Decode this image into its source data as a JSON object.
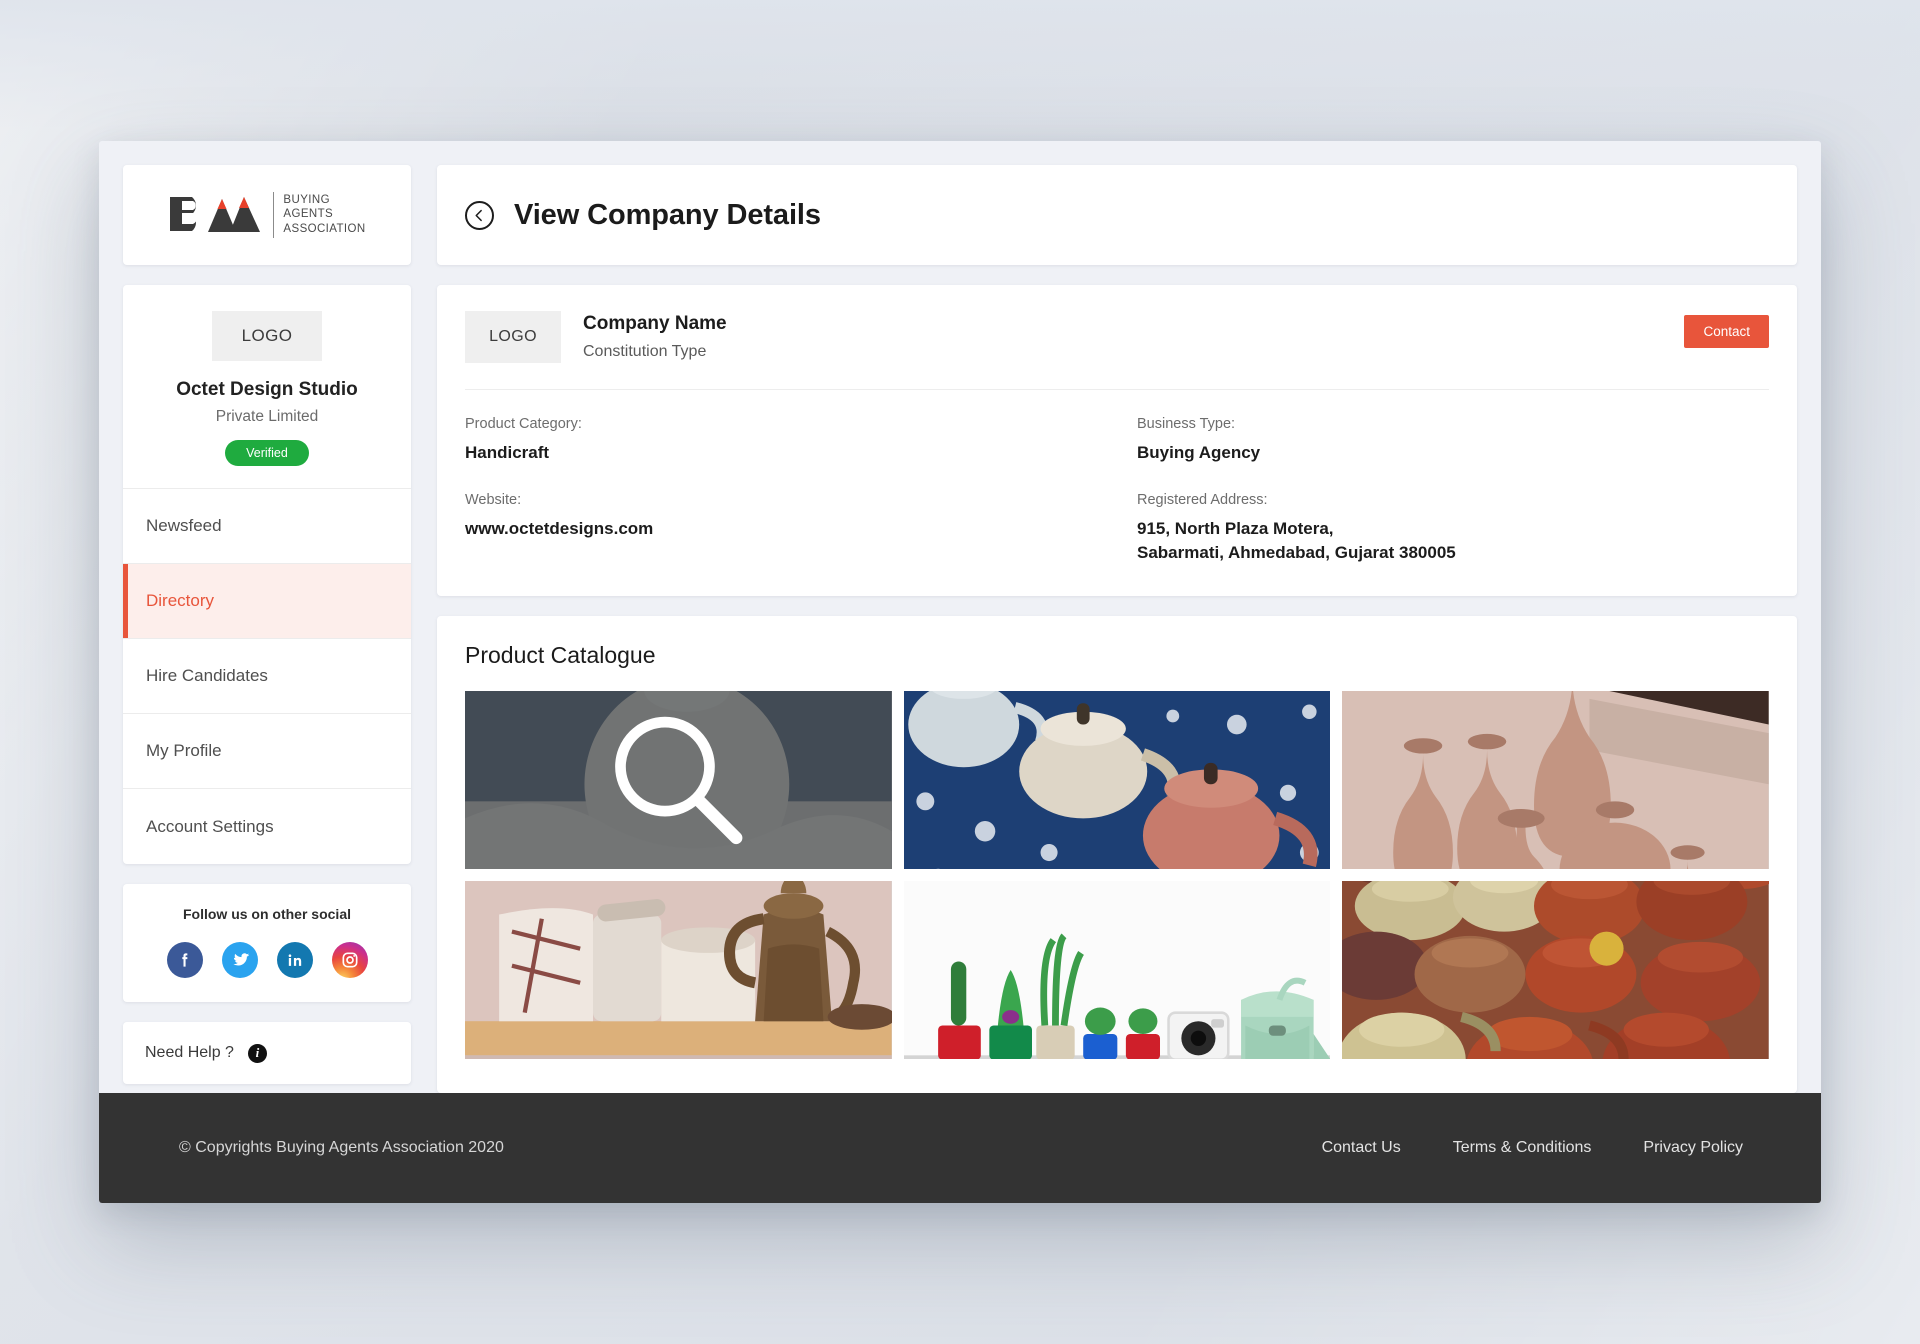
{
  "brand": {
    "mark_letters": "BAA",
    "lines": [
      "BUYING",
      "AGENTS",
      "ASSOCIATION"
    ]
  },
  "header": {
    "title": "View Company Details",
    "back_icon": "chevron-left-circle-icon"
  },
  "profile": {
    "logo_placeholder": "LOGO",
    "company_name": "Octet Design Studio",
    "constitution": "Private Limited",
    "verified_label": "Verified",
    "verified_color": "#1fab3f"
  },
  "sidebar": {
    "items": [
      {
        "label": "Newsfeed",
        "active": false
      },
      {
        "label": "Directory",
        "active": true
      },
      {
        "label": "Hire Candidates",
        "active": false
      },
      {
        "label": "My Profile",
        "active": false
      },
      {
        "label": "Account Settings",
        "active": false
      }
    ],
    "active_color": "#e8553b",
    "active_bg": "#fdeeeb"
  },
  "social": {
    "title": "Follow us on other social",
    "networks": [
      {
        "name": "facebook-icon",
        "color": "#3b5998"
      },
      {
        "name": "twitter-icon",
        "color": "#2aa3ef"
      },
      {
        "name": "linkedin-icon",
        "color": "#1378b0"
      },
      {
        "name": "instagram-icon",
        "color": "#cd2f8b"
      }
    ]
  },
  "help": {
    "label": "Need Help ?",
    "icon": "info-icon"
  },
  "company_details": {
    "logo_placeholder": "LOGO",
    "company_name": "Company Name",
    "constitution_type": "Constitution Type",
    "contact_button": "Contact",
    "contact_color": "#e8553b",
    "fields": [
      {
        "label": "Product Category:",
        "value": "Handicraft"
      },
      {
        "label": "Business Type:",
        "value": "Buying Agency"
      },
      {
        "label": "Website:",
        "value": "www.octetdesigns.com"
      },
      {
        "label": "Registered Address:",
        "value": "915, North Plaza Motera,\nSabarmati, Ahmedabad, Gujarat 380005"
      }
    ]
  },
  "catalogue": {
    "title": "Product Catalogue",
    "items": [
      {
        "alt": "grey-ceramic-vase",
        "hovered": true,
        "hover_icon": "magnifier-icon"
      },
      {
        "alt": "three-teapots-on-blue-floral-fabric",
        "hovered": false
      },
      {
        "alt": "terracotta-vases-group",
        "hovered": false
      },
      {
        "alt": "ceramic-jars-and-brass-teapot-on-shelf",
        "hovered": false
      },
      {
        "alt": "potted-plants-camera-and-mint-bag",
        "hovered": false
      },
      {
        "alt": "stacked-clay-teapots-market",
        "hovered": false
      }
    ]
  },
  "footer": {
    "copyright": "© Copyrights Buying Agents Association 2020",
    "links": [
      "Contact Us",
      "Terms & Conditions",
      "Privacy Policy"
    ],
    "bg_color": "#333333"
  }
}
